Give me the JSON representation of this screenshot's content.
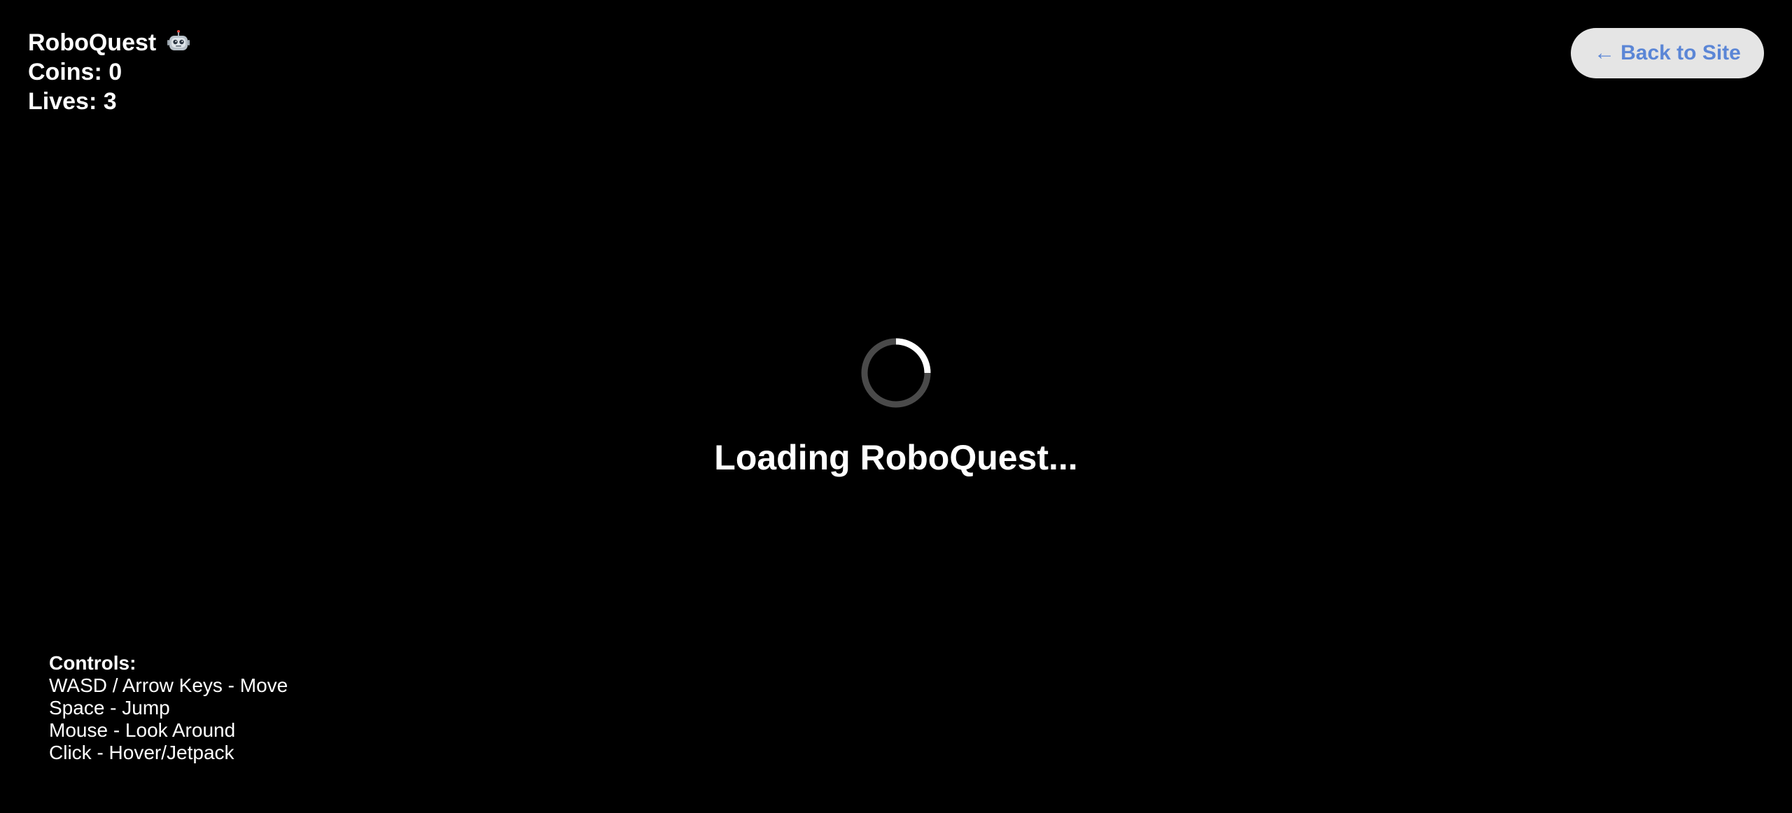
{
  "hud": {
    "title": "RoboQuest",
    "title_icon": "robot-icon",
    "coins": "Coins: 0",
    "lives": "Lives: 3"
  },
  "back_button": {
    "arrow": "←",
    "label": "Back to Site"
  },
  "loader": {
    "text": "Loading RoboQuest...",
    "spinner_icon": "loading-spinner-icon"
  },
  "controls": {
    "title": "Controls:",
    "items": [
      "WASD / Arrow Keys - Move",
      "Space - Jump",
      "Mouse - Look Around",
      "Click - Hover/Jetpack"
    ]
  },
  "colors": {
    "background": "#000000",
    "text": "#ffffff",
    "button_bg": "#e5e5e5",
    "button_text": "#5b86d6",
    "spinner_track": "#4a4a4a",
    "spinner_arc": "#ffffff"
  }
}
